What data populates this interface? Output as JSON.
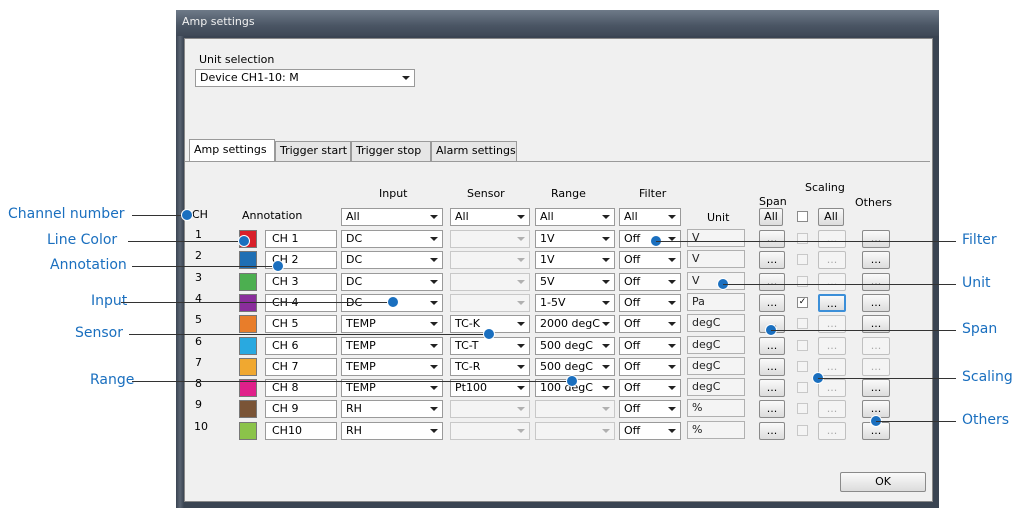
{
  "window": {
    "title": "Amp settings"
  },
  "unit_selection": {
    "label": "Unit selection",
    "value": "Device CH1-10: M"
  },
  "tabs": [
    {
      "label": "Amp settings",
      "active": true
    },
    {
      "label": "Trigger start",
      "active": false
    },
    {
      "label": "Trigger stop",
      "active": false
    },
    {
      "label": "Alarm settings",
      "active": false
    }
  ],
  "headers": {
    "ch": "CH",
    "annotation": "Annotation",
    "input": "Input",
    "sensor": "Sensor",
    "range": "Range",
    "filter": "Filter",
    "unit": "Unit",
    "span": "Span",
    "scaling": "Scaling",
    "others": "Others"
  },
  "all_row": {
    "input": "All",
    "sensor": "All",
    "range": "All",
    "filter": "All",
    "span_btn": "All",
    "scaling_btn": "All"
  },
  "rows": [
    {
      "ch": "1",
      "color": "#d8202a",
      "annotation": "CH 1",
      "input": "DC",
      "sensor": "",
      "range": "1V",
      "filter": "Off",
      "unit": "V",
      "scaling_checked": false,
      "scaling_enabled": false,
      "others_enabled": true
    },
    {
      "ch": "2",
      "color": "#1f6fb4",
      "annotation": "CH 2",
      "input": "DC",
      "sensor": "",
      "range": "1V",
      "filter": "Off",
      "unit": "V",
      "scaling_checked": false,
      "scaling_enabled": false,
      "others_enabled": true
    },
    {
      "ch": "3",
      "color": "#4caf50",
      "annotation": "CH 3",
      "input": "DC",
      "sensor": "",
      "range": "5V",
      "filter": "Off",
      "unit": "V",
      "scaling_checked": false,
      "scaling_enabled": false,
      "others_enabled": true
    },
    {
      "ch": "4",
      "color": "#8a2d9c",
      "annotation": "CH 4",
      "input": "DC",
      "sensor": "",
      "range": "1-5V",
      "filter": "Off",
      "unit": "Pa",
      "scaling_checked": true,
      "scaling_enabled": true,
      "others_enabled": true
    },
    {
      "ch": "5",
      "color": "#e87d2a",
      "annotation": "CH 5",
      "input": "TEMP",
      "sensor": "TC-K",
      "range": "2000 degC",
      "filter": "Off",
      "unit": "degC",
      "scaling_checked": false,
      "scaling_enabled": false,
      "others_enabled": true
    },
    {
      "ch": "6",
      "color": "#29a9e0",
      "annotation": "CH 6",
      "input": "TEMP",
      "sensor": "TC-T",
      "range": "500 degC",
      "filter": "Off",
      "unit": "degC",
      "scaling_checked": false,
      "scaling_enabled": false,
      "others_enabled": false
    },
    {
      "ch": "7",
      "color": "#f0a830",
      "annotation": "CH 7",
      "input": "TEMP",
      "sensor": "TC-R",
      "range": "500 degC",
      "filter": "Off",
      "unit": "degC",
      "scaling_checked": false,
      "scaling_enabled": false,
      "others_enabled": false
    },
    {
      "ch": "8",
      "color": "#e0208a",
      "annotation": "CH 8",
      "input": "TEMP",
      "sensor": "Pt100",
      "range": "100 degC",
      "filter": "Off",
      "unit": "degC",
      "scaling_checked": false,
      "scaling_enabled": false,
      "others_enabled": true
    },
    {
      "ch": "9",
      "color": "#7a5436",
      "annotation": "CH 9",
      "input": "RH",
      "sensor": "",
      "range": "",
      "filter": "Off",
      "unit": "%",
      "scaling_checked": false,
      "scaling_enabled": false,
      "others_enabled": true
    },
    {
      "ch": "10",
      "color": "#8bc34a",
      "annotation": "CH10",
      "input": "RH",
      "sensor": "",
      "range": "",
      "filter": "Off",
      "unit": "%",
      "scaling_checked": false,
      "scaling_enabled": false,
      "others_enabled": true
    }
  ],
  "dots_label": "...",
  "ok_button": "OK",
  "callouts": {
    "left": [
      "Channel number",
      "Line Color",
      "Annotation",
      "Input",
      "Sensor",
      "Range"
    ],
    "right": [
      "Filter",
      "Unit",
      "Span",
      "Scaling",
      "Others"
    ]
  }
}
